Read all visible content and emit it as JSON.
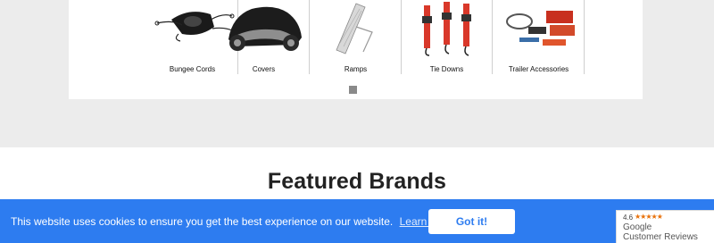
{
  "categories": [
    {
      "label": "Bungee Cords",
      "icon": "bungee-cords-image"
    },
    {
      "label": "Covers",
      "icon": "motorcycle-cover-image"
    },
    {
      "label": "Ramps",
      "icon": "ramp-image"
    },
    {
      "label": "Tie Downs",
      "icon": "tie-downs-image"
    },
    {
      "label": "Trailer Accessories",
      "icon": "trailer-accessories-image"
    }
  ],
  "brands": {
    "title": "Featured Brands"
  },
  "cookie": {
    "message": "This website uses cookies to ensure you get the best experience on our website.",
    "learn_more": "Learn More",
    "button": "Got it!"
  },
  "reviews": {
    "rating": "4.6",
    "stars": "★★★★★",
    "provider": "Google",
    "label": "Customer Reviews"
  },
  "colors": {
    "cookie_bar": "#2d7cf0",
    "star": "#e8710a",
    "page_bg": "#ececec",
    "tie_down_red": "#d9382a"
  }
}
